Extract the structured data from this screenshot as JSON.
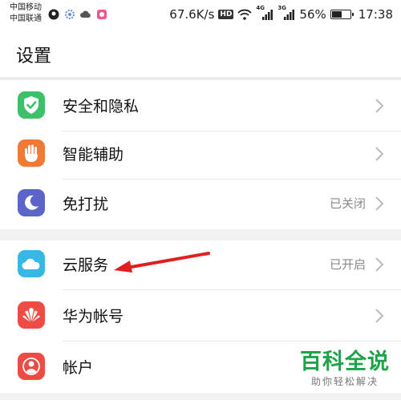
{
  "status_bar": {
    "carrier_1": "中国移动",
    "carrier_2": "中国联通",
    "net_speed": "67.6K/s",
    "hd_badge": "HD",
    "signal_1_label": "4G",
    "signal_2_label": "3G",
    "battery_percent_text": "56%",
    "battery_level": 0.56,
    "time": "17:38"
  },
  "header": {
    "title": "设置"
  },
  "settings": {
    "items": [
      {
        "label": "安全和隐私",
        "value": "",
        "icon": "shield-check-icon",
        "color": "#3ec06b"
      },
      {
        "label": "智能辅助",
        "value": "",
        "icon": "hand-icon",
        "color": "#f07a33"
      },
      {
        "label": "免打扰",
        "value": "已关闭",
        "icon": "moon-icon",
        "color": "#5b64c8"
      },
      {
        "label": "云服务",
        "value": "已开启",
        "icon": "cloud-icon",
        "color": "#36b8e2"
      },
      {
        "label": "华为帐号",
        "value": "",
        "icon": "huawei-logo-icon",
        "color": "#ee4b45"
      },
      {
        "label": "帐户",
        "value": "",
        "icon": "person-icon",
        "color": "#ee4b45"
      }
    ]
  },
  "watermark": {
    "main": "百科全说",
    "sub": "助你轻松解决"
  },
  "colors": {
    "annotation_arrow": "#e0201f",
    "watermark_green": "#1fa34a"
  }
}
